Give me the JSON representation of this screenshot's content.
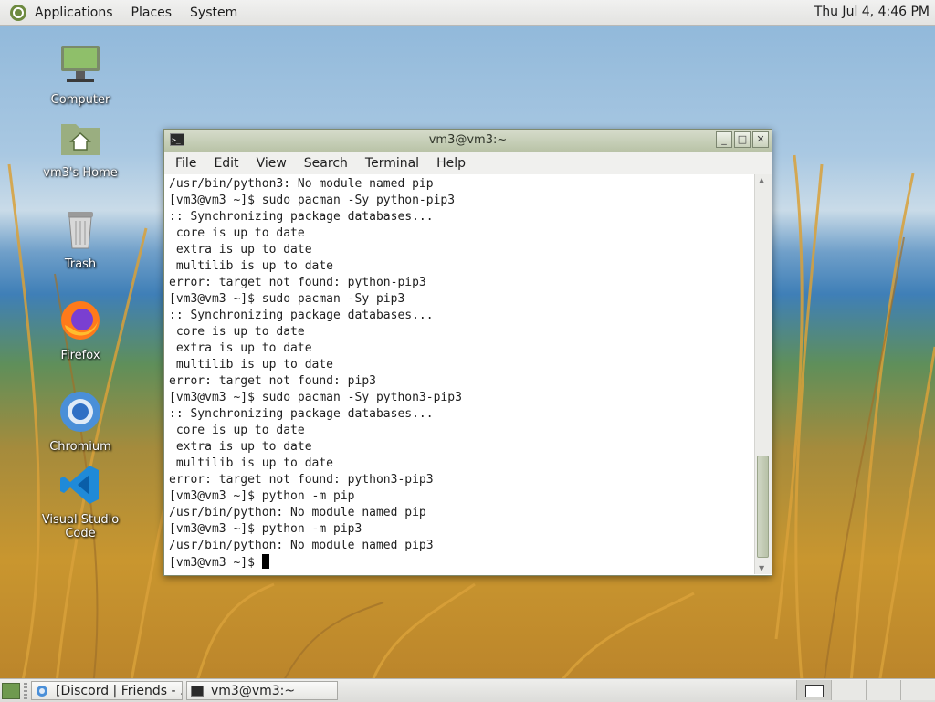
{
  "top_panel": {
    "menus": [
      "Applications",
      "Places",
      "System"
    ],
    "clock": "Thu Jul  4,  4:46 PM"
  },
  "desktop": {
    "icons": [
      {
        "label": "Computer",
        "icon": "computer-icon"
      },
      {
        "label": "vm3's Home",
        "icon": "home-folder-icon"
      },
      {
        "label": "Trash",
        "icon": "trash-icon"
      },
      {
        "label": "Firefox",
        "icon": "firefox-icon"
      },
      {
        "label": "Chromium",
        "icon": "chromium-icon"
      },
      {
        "label": "Visual Studio Code",
        "icon": "vscode-icon"
      }
    ]
  },
  "terminal": {
    "title": "vm3@vm3:~",
    "menus": [
      "File",
      "Edit",
      "View",
      "Search",
      "Terminal",
      "Help"
    ],
    "lines": [
      "/usr/bin/python3: No module named pip",
      "[vm3@vm3 ~]$ sudo pacman -Sy python-pip3",
      ":: Synchronizing package databases...",
      " core is up to date",
      " extra is up to date",
      " multilib is up to date",
      "error: target not found: python-pip3",
      "[vm3@vm3 ~]$ sudo pacman -Sy pip3",
      ":: Synchronizing package databases...",
      " core is up to date",
      " extra is up to date",
      " multilib is up to date",
      "error: target not found: pip3",
      "[vm3@vm3 ~]$ sudo pacman -Sy python3-pip3",
      ":: Synchronizing package databases...",
      " core is up to date",
      " extra is up to date",
      " multilib is up to date",
      "error: target not found: python3-pip3",
      "[vm3@vm3 ~]$ python -m pip",
      "/usr/bin/python: No module named pip",
      "[vm3@vm3 ~]$ python -m pip3",
      "/usr/bin/python: No module named pip3"
    ],
    "prompt": "[vm3@vm3 ~]$ "
  },
  "taskbar": {
    "tasks": [
      "[Discord | Friends - ...",
      "vm3@vm3:~"
    ]
  }
}
